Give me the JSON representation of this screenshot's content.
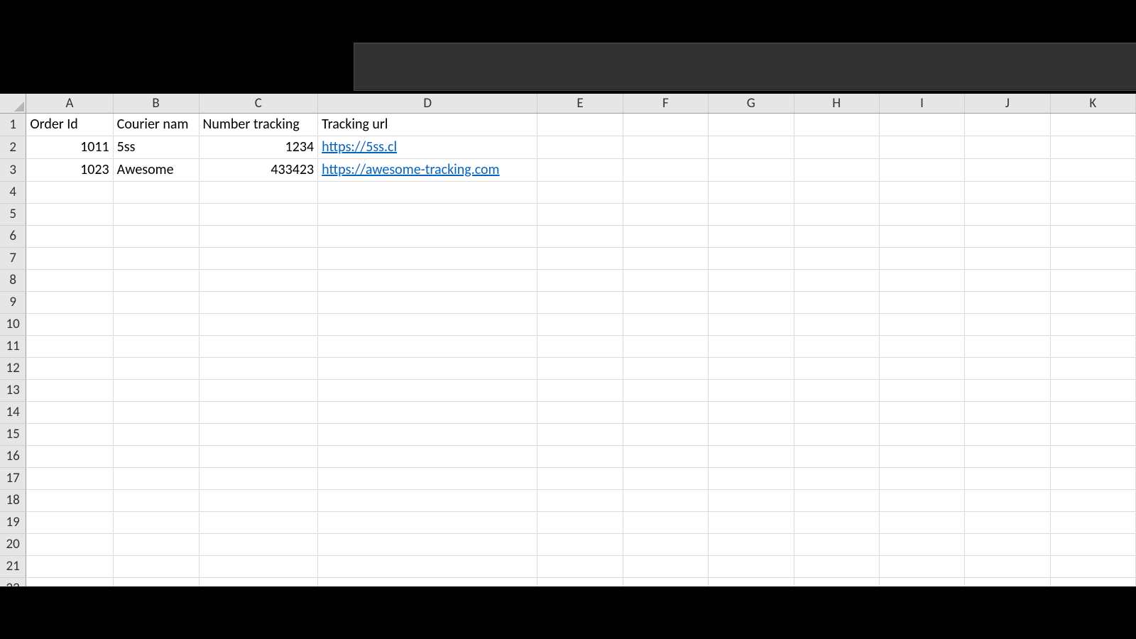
{
  "columns": [
    "A",
    "B",
    "C",
    "D",
    "E",
    "F",
    "G",
    "H",
    "I",
    "J",
    "K"
  ],
  "rowCount": 22,
  "headerRowVisible": 1,
  "data": {
    "headers": {
      "A": "Order Id",
      "B": "Courier nam",
      "C": "Number tracking",
      "D": "Tracking url"
    },
    "rows": [
      {
        "A": "1011",
        "B": "5ss",
        "C": "1234",
        "D": "https://5ss.cl"
      },
      {
        "A": "1023",
        "B": "Awesome",
        "C": "433423",
        "D": "https://awesome-tracking.com"
      }
    ]
  },
  "colors": {
    "link": "#0563c1",
    "gridBorder": "#dcdcdc",
    "headerFill": "#e6e6e6",
    "ribbonFill": "#323232"
  }
}
